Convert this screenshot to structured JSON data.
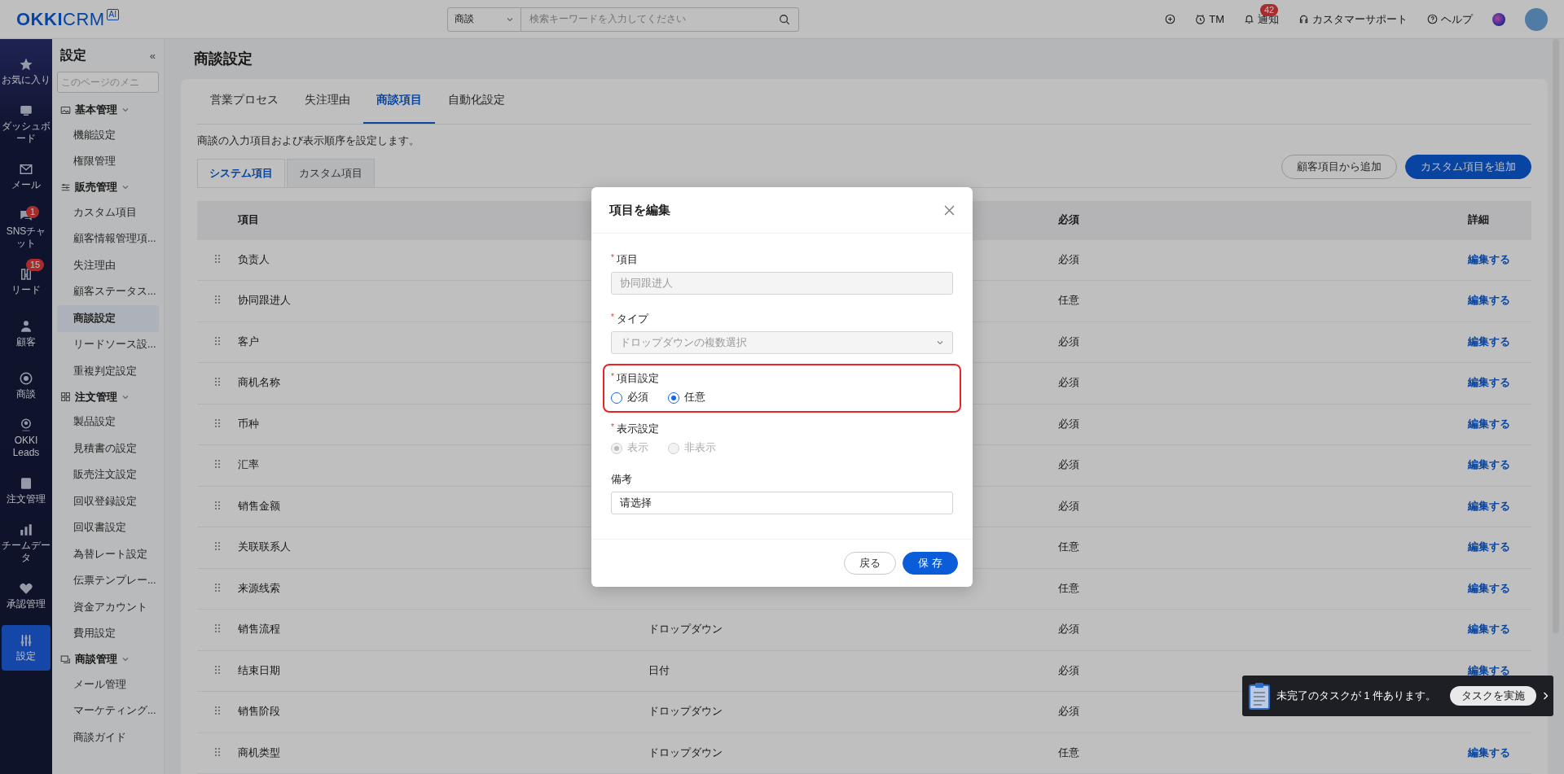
{
  "top_bar": {
    "logo": "**OKKI**CRM",
    "logo_badge": "AI",
    "search": {
      "scope": "商談",
      "placeholder": "検索キーワードを入力してください"
    },
    "actions": [
      {
        "kind": "add"
      },
      {
        "kind": "clock",
        "label": "TM"
      },
      {
        "kind": "bell",
        "label": "通知",
        "badge": "42"
      },
      {
        "kind": "headset",
        "label": "カスタマーサポート"
      },
      {
        "kind": "help",
        "label": "ヘルプ"
      },
      {
        "kind": "orb"
      },
      {
        "kind": "avatar"
      }
    ]
  },
  "nav": [
    {
      "label": "お気に入り",
      "selected": false
    },
    {
      "label": "ダッシュボード",
      "selected": false
    },
    {
      "label": "メール",
      "selected": false
    },
    {
      "label": "SNSチャット",
      "badge": "1",
      "selected": false
    },
    {
      "label": "リード",
      "badge": "15",
      "selected": false
    },
    {
      "label": "顧客",
      "selected": false
    },
    {
      "label": "商談",
      "selected": false
    },
    {
      "label": "OKKI Leads",
      "selected": false
    },
    {
      "label": "注文管理",
      "selected": false
    },
    {
      "label": "チームデータ",
      "selected": false
    },
    {
      "label": "承認管理",
      "selected": false
    },
    {
      "label": "設定",
      "selected": true
    }
  ],
  "settings_sidebar": {
    "title": "設定",
    "collapse": "«",
    "search_placeholder": "このページのメニ",
    "groups": [
      {
        "label": "基本管理",
        "expanded": true,
        "children": [
          {
            "label": "機能設定",
            "selected": false
          },
          {
            "label": "権限管理",
            "selected": false
          }
        ]
      },
      {
        "label": "販売管理",
        "expanded": true,
        "children": [
          {
            "label": "カスタム項目",
            "selected": false
          },
          {
            "label": "顧客情報管理項...",
            "selected": false
          },
          {
            "label": "失注理由",
            "selected": false
          },
          {
            "label": "顧客ステータス...",
            "selected": false
          },
          {
            "label": "商談設定",
            "selected": true
          },
          {
            "label": "リードソース設...",
            "selected": false
          },
          {
            "label": "重複判定設定",
            "selected": false
          }
        ]
      },
      {
        "label": "注文管理",
        "expanded": true,
        "children": [
          {
            "label": "製品設定",
            "selected": false
          },
          {
            "label": "見積書の設定",
            "selected": false
          },
          {
            "label": "販売注文設定",
            "selected": false
          },
          {
            "label": "回収登録設定",
            "selected": false
          },
          {
            "label": "回収書設定",
            "selected": false
          },
          {
            "label": "為替レート設定",
            "selected": false
          },
          {
            "label": "伝票テンプレー...",
            "selected": false
          },
          {
            "label": "資金アカウント",
            "selected": false
          },
          {
            "label": "費用設定",
            "selected": false
          }
        ]
      },
      {
        "label": "商談管理",
        "expanded": true,
        "children": [
          {
            "label": "メール管理",
            "selected": false
          },
          {
            "label": "マーケティング...",
            "selected": false
          },
          {
            "label": "商談ガイド",
            "selected": false
          }
        ]
      }
    ]
  },
  "page": {
    "title": "商談設定",
    "tabs": [
      {
        "label": "営業プロセス",
        "selected": false
      },
      {
        "label": "失注理由",
        "selected": false
      },
      {
        "label": "商談項目",
        "selected": true
      },
      {
        "label": "自動化設定",
        "selected": false
      }
    ],
    "description": "商談の入力項目および表示順序を設定します。",
    "subtabs": [
      {
        "label": "システム項目",
        "selected": true
      },
      {
        "label": "カスタム項目",
        "selected": false
      }
    ],
    "buttons": [
      {
        "label": "顧客項目から追加",
        "kind": "secondary"
      },
      {
        "label": "カスタム項目を追加",
        "kind": "primary"
      }
    ],
    "table": {
      "columns": [
        "項目",
        "必須",
        "詳細"
      ],
      "rows": [
        {
          "name": "负责人",
          "required": "必須",
          "action": "編集する"
        },
        {
          "name": "协同跟进人",
          "required": "任意",
          "action": "編集する"
        },
        {
          "name": "客户",
          "required": "必須",
          "action": "編集する"
        },
        {
          "name": "商机名称",
          "required": "必須",
          "action": "編集する"
        },
        {
          "name": "币种",
          "required": "必須",
          "action": "編集する"
        },
        {
          "name": "汇率",
          "required": "必須",
          "action": "編集する"
        },
        {
          "name": "销售金额",
          "required": "必須",
          "action": "編集する"
        },
        {
          "name": "关联联系人",
          "required": "任意",
          "action": "編集する"
        },
        {
          "name": "来源线索",
          "required": "任意",
          "action": "編集する"
        },
        {
          "name": "销售流程",
          "type": "ドロップダウン",
          "required": "必須",
          "action": "編集する"
        },
        {
          "name": "结束日期",
          "type": "日付",
          "required": "必須",
          "action": "編集する"
        },
        {
          "name": "销售阶段",
          "type": "ドロップダウン",
          "required": "必須"
        },
        {
          "name": "商机类型",
          "type": "ドロップダウン",
          "required": "任意",
          "action": "編集する"
        }
      ]
    }
  },
  "modal": {
    "title": "項目を編集",
    "fields": [
      {
        "kind": "input",
        "label": "項目",
        "required_mark": "*",
        "disabled": true,
        "highlighted": false,
        "value": "协同跟进人"
      },
      {
        "kind": "select",
        "label": "タイプ",
        "required_mark": "*",
        "disabled": true,
        "highlighted": false,
        "value": "ドロップダウンの複数選択"
      },
      {
        "kind": "radio",
        "label": "項目設定",
        "required_mark": "*",
        "disabled": false,
        "highlighted": true,
        "options": [
          {
            "label": "必須",
            "selected": false
          },
          {
            "label": "任意",
            "selected": true
          }
        ]
      },
      {
        "kind": "radio",
        "label": "表示設定",
        "required_mark": "*",
        "disabled": true,
        "highlighted": false,
        "options": [
          {
            "label": "表示",
            "selected": true
          },
          {
            "label": "非表示",
            "selected": false
          }
        ]
      },
      {
        "kind": "input",
        "label": "備考",
        "disabled": false,
        "highlighted": false,
        "value": "请选择"
      }
    ],
    "buttons": [
      {
        "label": "戻る",
        "kind": "secondary"
      },
      {
        "label": "保 存",
        "kind": "primary"
      }
    ]
  },
  "toast": {
    "message": "未完了のタスクが 1 件あります。",
    "button": "タスクを実施"
  }
}
